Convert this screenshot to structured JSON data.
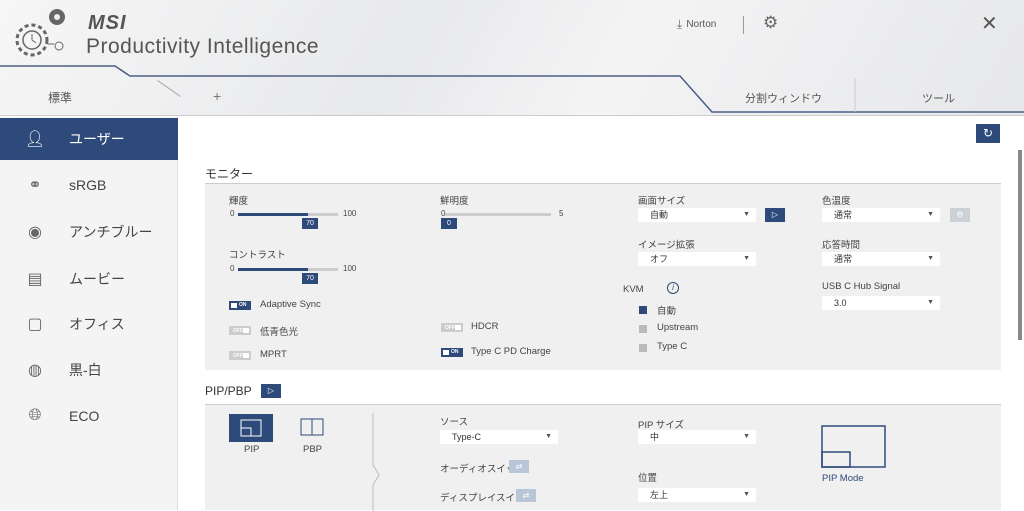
{
  "header": {
    "brand": "msi",
    "title": "Productivity Intelligence",
    "norton": "Norton"
  },
  "tabs": {
    "standard": "標準",
    "add": "+",
    "split_window": "分割ウィンドウ",
    "tools": "ツール"
  },
  "sidebar": {
    "items": [
      {
        "label": "ユーザー",
        "icon": "user-icon"
      },
      {
        "label": "sRGB",
        "icon": "color-circles-icon"
      },
      {
        "label": "アンチブルー",
        "icon": "eye-icon"
      },
      {
        "label": "ムービー",
        "icon": "film-icon"
      },
      {
        "label": "オフィス",
        "icon": "briefcase-icon"
      },
      {
        "label": "黒-白",
        "icon": "black-white-icon"
      },
      {
        "label": "ECO",
        "icon": "globe-icon"
      }
    ]
  },
  "monitor": {
    "title": "モニター",
    "brightness": {
      "label": "輝度",
      "min": "0",
      "max": "100",
      "value": "70",
      "fraction": 0.7
    },
    "sharpness": {
      "label": "鮮明度",
      "min": "0",
      "max": "5",
      "value": "0",
      "fraction": 0
    },
    "contrast": {
      "label": "コントラスト",
      "min": "0",
      "max": "100",
      "value": "70",
      "fraction": 0.7
    },
    "toggles": {
      "adaptive_sync": {
        "label": "Adaptive Sync",
        "state": "ON"
      },
      "low_blue": {
        "label": "低青色光",
        "state": "OFF"
      },
      "mprt": {
        "label": "MPRT",
        "state": "OFF"
      },
      "hdcr": {
        "label": "HDCR",
        "state": "OFF"
      },
      "typec_pd": {
        "label": "Type C PD Charge",
        "state": "ON"
      }
    },
    "screen_size": {
      "label": "画面サイズ",
      "value": "自動"
    },
    "image_enhance": {
      "label": "イメージ拡張",
      "value": "オフ"
    },
    "kvm": {
      "label": "KVM",
      "options": [
        "自動",
        "Upstream",
        "Type C"
      ],
      "selected": "自動"
    },
    "color_temp": {
      "label": "色温度",
      "value": "通常"
    },
    "response_time": {
      "label": "応答時間",
      "value": "通常"
    },
    "usbc_hub": {
      "label": "USB C Hub Signal",
      "value": "3.0"
    }
  },
  "pip": {
    "title": "PIP/PBP",
    "pip_label": "PIP",
    "pbp_label": "PBP",
    "source_label": "ソース",
    "source_value": "Type-C",
    "audio_switch": "オーディオスイッチ",
    "display_switch": "ディスプレイスイッチ",
    "size_label": "PIP サイズ",
    "size_value": "中",
    "position_label": "位置",
    "position_value": "左上",
    "mode_label": "PIP Mode"
  },
  "colors": {
    "accent": "#2e4a7a"
  }
}
